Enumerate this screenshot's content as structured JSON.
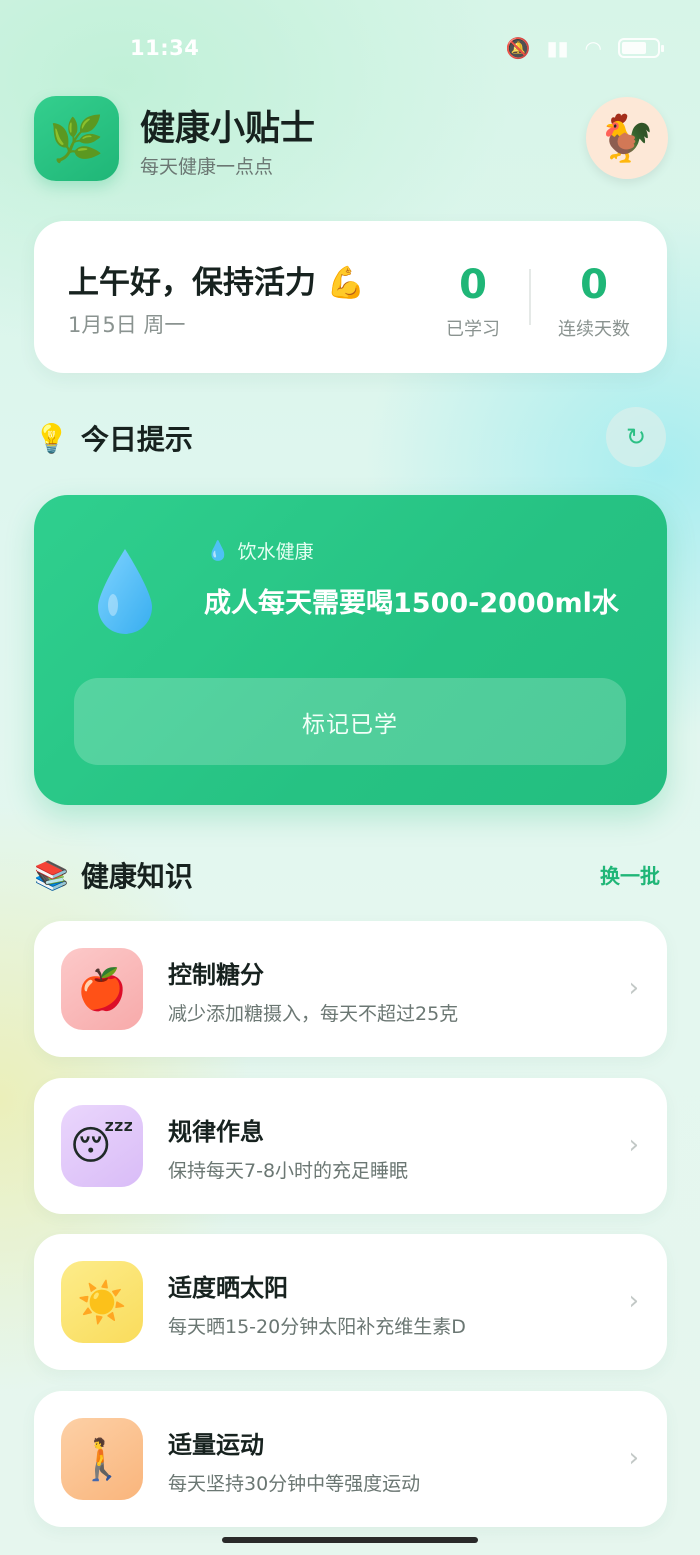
{
  "status": {
    "time": "11:34"
  },
  "header": {
    "title": "健康小贴士",
    "subtitle": "每天健康一点点",
    "logo_icon": "leaf-icon",
    "avatar_icon": "rooster-avatar"
  },
  "greeting": {
    "text": "上午好，保持活力 💪",
    "date": "1月5日 周一",
    "stats": [
      {
        "value": "0",
        "label": "已学习"
      },
      {
        "value": "0",
        "label": "连续天数"
      }
    ]
  },
  "today": {
    "title": "今日提示",
    "refresh_icon": "↻"
  },
  "tip": {
    "category": "饮水健康",
    "text": "成人每天需要喝1500-2000ml水",
    "button": "标记已学"
  },
  "knowledge": {
    "title": "健康知识",
    "swap": "换一批",
    "items": [
      {
        "icon": "🍎",
        "title": "控制糖分",
        "desc": "减少添加糖摄入，每天不超过25克",
        "bg": "#fbc3c3"
      },
      {
        "icon": "😴",
        "title": "规律作息",
        "desc": "保持每天7-8小时的充足睡眠",
        "bg": "#e4cdfa"
      },
      {
        "icon": "☀️",
        "title": "适度晒太阳",
        "desc": "每天晒15-20分钟太阳补充维生素D",
        "bg": "#fbe680"
      },
      {
        "icon": "🚶",
        "title": "适量运动",
        "desc": "每天坚持30分钟中等强度运动",
        "bg": "#fcc79a"
      }
    ]
  },
  "colors": {
    "accent": "#1fb677",
    "tip_card": "#26c283"
  }
}
